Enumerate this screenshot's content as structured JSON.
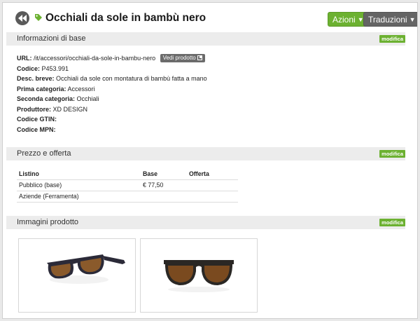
{
  "header": {
    "title": "Occhiali da sole in bambù nero",
    "actions_label": "Azioni",
    "translations_label": "Traduzioni"
  },
  "colors": {
    "accent": "#6cb131",
    "dark_button": "#646464",
    "section_bg": "#ececec"
  },
  "sections": {
    "basic": {
      "title": "Informazioni di base",
      "edit_label": "modifica"
    },
    "price": {
      "title": "Prezzo e offerta",
      "edit_label": "modifica"
    },
    "images": {
      "title": "Immagini prodotto",
      "edit_label": "modifica"
    }
  },
  "info": {
    "url": {
      "label": "URL:",
      "value": "/it/accessori/occhiali-da-sole-in-bambu-nero",
      "button": "Vedi prodotto"
    },
    "code": {
      "label": "Codice:",
      "value": "P453.991"
    },
    "short_desc": {
      "label": "Desc. breve:",
      "value": "Occhiali da sole con montatura di bambù fatta a mano"
    },
    "first_category": {
      "label": "Prima categoria:",
      "value": "Accessori"
    },
    "second_category": {
      "label": "Seconda categoria:",
      "value": "Occhiali"
    },
    "producer": {
      "label": "Produttore:",
      "value": "XD DESIGN"
    },
    "gtin": {
      "label": "Codice GTIN:",
      "value": ""
    },
    "mpn": {
      "label": "Codice MPN:",
      "value": ""
    }
  },
  "price_table": {
    "headers": [
      "Listino",
      "Base",
      "Offerta"
    ],
    "rows": [
      [
        "Pubblico (base)",
        "€ 77,50",
        ""
      ],
      [
        "Aziende (Ferramenta)",
        "",
        ""
      ]
    ]
  },
  "icons": [
    "back-icon",
    "tag-icon",
    "chevron-down-icon",
    "external-link-icon"
  ]
}
